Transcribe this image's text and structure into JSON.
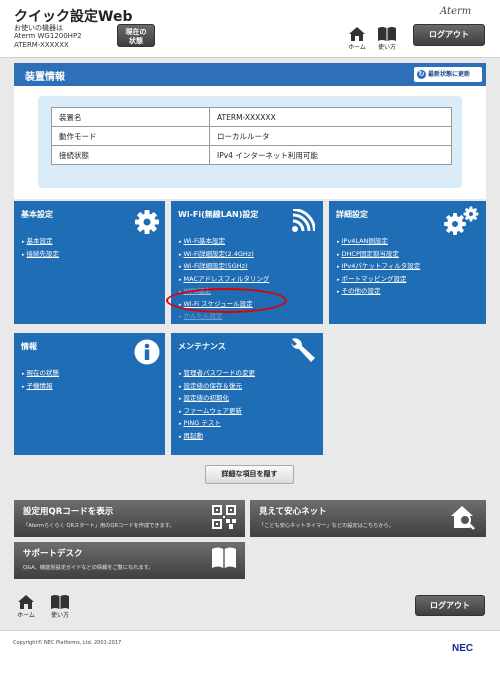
{
  "header": {
    "app_title": "クイック設定Web",
    "device_line1": "お使いの機器は",
    "device_line2": "Aterm WG1200HP2",
    "device_line3": "ATERM-XXXXXX",
    "status_button_line1": "現在の",
    "status_button_line2": "状態",
    "brand_logo": "Aterm",
    "home_label": "ホーム",
    "help_label": "使い方",
    "logout_label": "ログアウト"
  },
  "device_info": {
    "title": "装置情報",
    "refresh_label": "最新状態に更新",
    "rows": [
      {
        "key": "装置名",
        "value": "ATERM-XXXXXX"
      },
      {
        "key": "動作モード",
        "value": "ローカルルータ"
      },
      {
        "key": "接続状態",
        "value": "IPv4 インターネット利用可能"
      }
    ]
  },
  "tiles": {
    "basic": {
      "title": "基本設定",
      "icon": "gear-icon",
      "links": [
        "基本設定",
        "接続先設定"
      ]
    },
    "wifi": {
      "title": "Wi-Fi(無線LAN)設定",
      "icon": "wifi-icon",
      "links": [
        "Wi-Fi基本設定",
        "Wi-Fi詳細設定(2.4GHz)",
        "Wi-Fi詳細設定(5GHz)",
        "MACアドレスフィルタリング",
        "WPS設定",
        "Wi-Fi スケジュール設定",
        "かんたん設定"
      ]
    },
    "advanced": {
      "title": "詳細設定",
      "icon": "gears-icon",
      "links": [
        "IPv4LAN側設定",
        "DHCP固定割当設定",
        "IPv4パケットフィルタ設定",
        "ポートマッピング設定",
        "その他の設定"
      ]
    },
    "info": {
      "title": "情報",
      "icon": "info-icon",
      "links": [
        "現在の状態",
        "子機情報"
      ]
    },
    "maintenance": {
      "title": "メンテナンス",
      "icon": "wrench-icon",
      "links": [
        "管理者パスワードの変更",
        "設定値の保存＆復元",
        "設定値の初期化",
        "ファームウェア更新",
        "PING テスト",
        "再起動"
      ]
    }
  },
  "hide_detail_label": "詳細な項目を隠す",
  "cards": {
    "qr": {
      "title": "設定用QRコードを表示",
      "desc": "「Atermらくらく QRスタート」用のQRコードを作成できます。",
      "icon": "qr-code-icon"
    },
    "net": {
      "title": "見えて安心ネット",
      "desc": "「こども安心ネットタイマー」などの設定はこちらから。",
      "icon": "house-search-icon"
    },
    "support": {
      "title": "サポートデスク",
      "desc": "Q&A、機能別設定ガイドなどの情報をご覧になれます。",
      "icon": "book-icon"
    }
  },
  "footer": {
    "home_label": "ホーム",
    "help_label": "使い方",
    "logout_label": "ログアウト",
    "copyright": "Copyright© NEC Platforms, Ltd. 2001-2017",
    "logo": "NEC"
  },
  "colors": {
    "tile_blue": "#1f6db5",
    "header_blue": "#2d70b8",
    "highlight": "#e00000"
  }
}
